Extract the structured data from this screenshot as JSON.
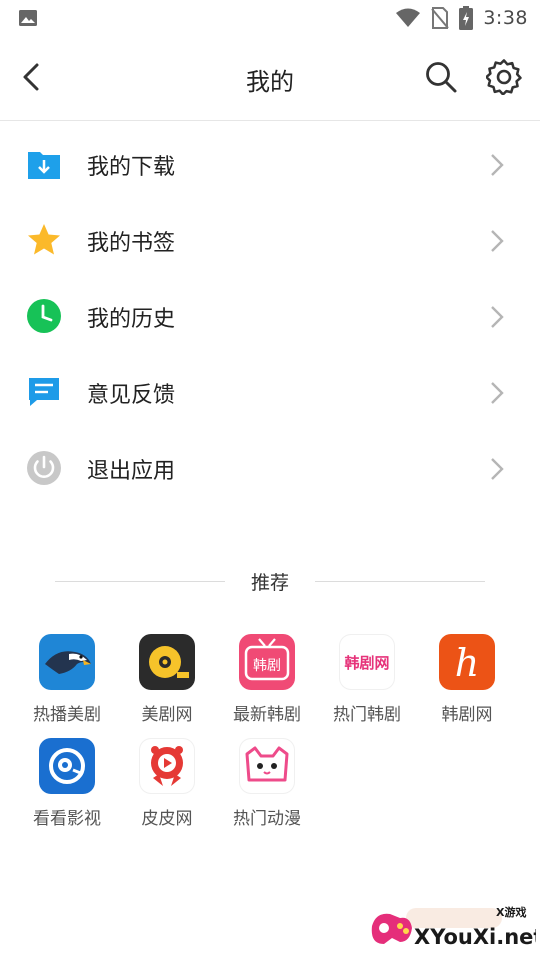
{
  "status_bar": {
    "time": "3:38"
  },
  "header": {
    "title": "我的"
  },
  "menu": [
    {
      "label": "我的下载",
      "icon": "download-folder-icon",
      "color": "#1ea0ea"
    },
    {
      "label": "我的书签",
      "icon": "star-icon",
      "color": "#fbb92a"
    },
    {
      "label": "我的历史",
      "icon": "history-clock-icon",
      "color": "#17c257"
    },
    {
      "label": "意见反馈",
      "icon": "feedback-chat-icon",
      "color": "#1e9be8"
    },
    {
      "label": "退出应用",
      "icon": "power-icon",
      "color": "#c8c8c8"
    }
  ],
  "recommend": {
    "title": "推荐",
    "apps": [
      {
        "label": "热播美剧",
        "icon": "eagle-app-icon"
      },
      {
        "label": "美剧网",
        "icon": "film-reel-app-icon"
      },
      {
        "label": "最新韩剧",
        "icon": "tv-app-icon",
        "badge": "韩剧"
      },
      {
        "label": "热门韩剧",
        "icon": "text-logo-app-icon",
        "badge": "韩剧网"
      },
      {
        "label": "韩剧网",
        "icon": "h-letter-app-icon",
        "badge": "h"
      },
      {
        "label": "看看影视",
        "icon": "eye-app-icon"
      },
      {
        "label": "皮皮网",
        "icon": "play-mascot-app-icon"
      },
      {
        "label": "热门动漫",
        "icon": "cat-face-app-icon"
      }
    ]
  },
  "watermark": {
    "brand": "XYouXi.net",
    "tag": "X游戏"
  }
}
